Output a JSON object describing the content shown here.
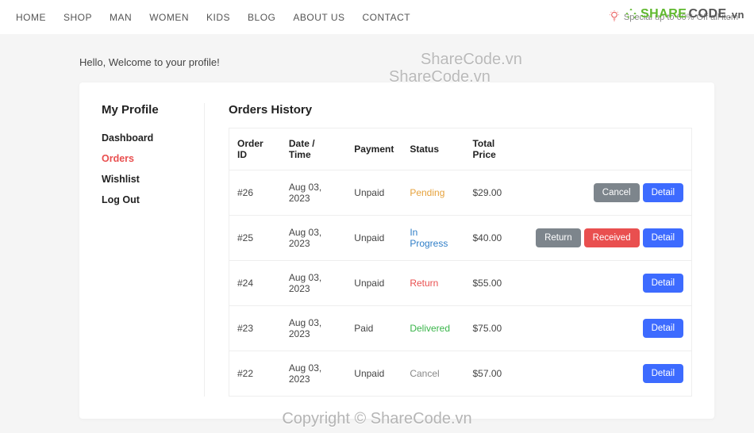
{
  "nav": {
    "items": [
      "HOME",
      "SHOP",
      "MAN",
      "WOMEN",
      "KIDS",
      "BLOG",
      "ABOUT US",
      "CONTACT"
    ]
  },
  "promo": {
    "text": "Special up to 60% Off all item"
  },
  "logo": {
    "share": "SHARE",
    "code": "CODE",
    "vn": ".vn"
  },
  "welcome": "Hello, Welcome to your profile!",
  "sidebar": {
    "title": "My Profile",
    "items": [
      {
        "label": "Dashboard",
        "active": false
      },
      {
        "label": "Orders",
        "active": true
      },
      {
        "label": "Wishlist",
        "active": false
      },
      {
        "label": "Log Out",
        "active": false
      }
    ]
  },
  "main": {
    "title": "Orders History",
    "columns": [
      "Order ID",
      "Date / Time",
      "Payment",
      "Status",
      "Total Price",
      ""
    ],
    "rows": [
      {
        "id": "#26",
        "date": "Aug 03, 2023",
        "payment": "Unpaid",
        "status": "Pending",
        "status_class": "status-pending",
        "price": "$29.00",
        "actions": [
          {
            "label": "Cancel",
            "cls": "btn-grey"
          },
          {
            "label": "Detail",
            "cls": "btn-blue"
          }
        ]
      },
      {
        "id": "#25",
        "date": "Aug 03, 2023",
        "payment": "Unpaid",
        "status": "In Progress",
        "status_class": "status-inprogress",
        "price": "$40.00",
        "actions": [
          {
            "label": "Return",
            "cls": "btn-grey"
          },
          {
            "label": "Received",
            "cls": "btn-red"
          },
          {
            "label": "Detail",
            "cls": "btn-blue"
          }
        ]
      },
      {
        "id": "#24",
        "date": "Aug 03, 2023",
        "payment": "Unpaid",
        "status": "Return",
        "status_class": "status-return",
        "price": "$55.00",
        "actions": [
          {
            "label": "Detail",
            "cls": "btn-blue"
          }
        ]
      },
      {
        "id": "#23",
        "date": "Aug 03, 2023",
        "payment": "Paid",
        "status": "Delivered",
        "status_class": "status-delivered",
        "price": "$75.00",
        "actions": [
          {
            "label": "Detail",
            "cls": "btn-blue"
          }
        ]
      },
      {
        "id": "#22",
        "date": "Aug 03, 2023",
        "payment": "Unpaid",
        "status": "Cancel",
        "status_class": "status-cancel",
        "price": "$57.00",
        "actions": [
          {
            "label": "Detail",
            "cls": "btn-blue"
          }
        ]
      }
    ]
  },
  "watermarks": {
    "wm1": "ShareCode.vn",
    "wm2": "ShareCode.vn"
  },
  "footer": "Copyright © ShareCode.vn"
}
